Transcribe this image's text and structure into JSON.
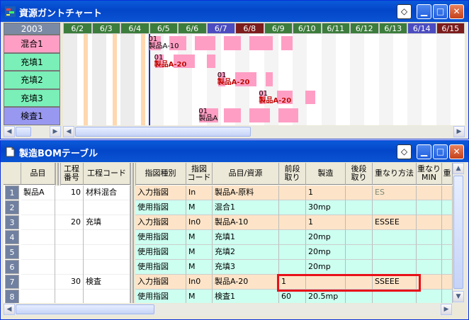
{
  "colors": {
    "title_blue": "#0a54d3",
    "bar_pink": "#ff9ec4",
    "row_orange": "#fde4c8",
    "row_cyan": "#ccfff0",
    "highlight_red": "#e8101a"
  },
  "gantt_window": {
    "title": "資源ガントチャート",
    "icon": "gantt-app-icon",
    "year": "2003",
    "days": [
      {
        "label": "6/2",
        "kind": "weekday"
      },
      {
        "label": "6/3",
        "kind": "weekday"
      },
      {
        "label": "6/4",
        "kind": "weekday"
      },
      {
        "label": "6/5",
        "kind": "weekday"
      },
      {
        "label": "6/6",
        "kind": "weekday"
      },
      {
        "label": "6/7",
        "kind": "saturday"
      },
      {
        "label": "6/8",
        "kind": "sunday"
      },
      {
        "label": "6/9",
        "kind": "weekday"
      },
      {
        "label": "6/10",
        "kind": "weekday"
      },
      {
        "label": "6/11",
        "kind": "weekday"
      },
      {
        "label": "6/12",
        "kind": "weekday"
      },
      {
        "label": "6/13",
        "kind": "weekday"
      },
      {
        "label": "6/14",
        "kind": "saturday"
      },
      {
        "label": "6/15",
        "kind": "sunday"
      }
    ],
    "resources": [
      {
        "label": "混合1",
        "color": "#ff9ec4"
      },
      {
        "label": "充填1",
        "color": "#7af0b8"
      },
      {
        "label": "充填2",
        "color": "#7af0b8"
      },
      {
        "label": "充填3",
        "color": "#7af0b8"
      },
      {
        "label": "検査1",
        "color": "#9898f0"
      }
    ],
    "tasks": [
      {
        "row": 0,
        "num": "01",
        "name": "製品A-10",
        "style": "plain",
        "start_day": 3.0,
        "segments": [
          [
            3.0,
            3.4
          ],
          [
            3.7,
            4.3
          ],
          [
            4.6,
            5.3
          ],
          [
            5.6,
            6.2
          ],
          [
            6.5,
            7.3
          ],
          [
            7.6,
            8.0
          ]
        ]
      },
      {
        "row": 1,
        "num": "01",
        "name": "製品A-20",
        "style": "outlined",
        "start_day": 3.2,
        "segments": [
          [
            3.2,
            3.5
          ],
          [
            3.85,
            4.6
          ],
          [
            5.0,
            5.3
          ]
        ]
      },
      {
        "row": 2,
        "num": "01",
        "name": "製品A-20",
        "style": "outlined",
        "start_day": 5.4,
        "segments": [
          [
            5.4,
            5.65
          ],
          [
            6.0,
            6.75
          ],
          [
            7.05,
            7.3
          ]
        ]
      },
      {
        "row": 3,
        "num": "01",
        "name": "製品A-20",
        "style": "outlined",
        "start_day": 6.85,
        "segments": [
          [
            6.85,
            7.05
          ],
          [
            7.45,
            8.0
          ],
          [
            8.45,
            8.8
          ]
        ]
      },
      {
        "row": 4,
        "num": "01",
        "name": "製品A",
        "style": "plain",
        "start_day": 4.75,
        "segments": [
          [
            4.75,
            5.4
          ],
          [
            5.6,
            6.2
          ],
          [
            6.5,
            7.2
          ],
          [
            7.5,
            8.2
          ]
        ]
      }
    ]
  },
  "bom_window": {
    "title": "製造BOMテーブル",
    "icon": "document-icon",
    "headers": [
      "品目",
      "工程\n番号",
      "工程コード",
      "指図種別",
      "指図\nコード",
      "品目/資源",
      "前段\n取り",
      "製造",
      "後段\n取り",
      "重なり方法",
      "重なり\nMIN",
      "重"
    ],
    "rows": [
      {
        "n": "1",
        "item": "製品A",
        "pnum": "10",
        "pcode": "材料混合",
        "kind": "入力指図",
        "code": "In",
        "res": "製品A-原料",
        "pre": "",
        "mfg": "1",
        "post": "",
        "method": "ES",
        "min": "",
        "method_dim": true
      },
      {
        "n": "2",
        "item": "",
        "pnum": "",
        "pcode": "",
        "kind": "使用指図",
        "code": "M",
        "res": "混合1",
        "pre": "",
        "mfg": "30mp",
        "post": "",
        "method": "",
        "min": ""
      },
      {
        "n": "3",
        "item": "",
        "pnum": "20",
        "pcode": "充填",
        "kind": "入力指図",
        "code": "In0",
        "res": "製品A-10",
        "pre": "",
        "mfg": "1",
        "post": "",
        "method": "ESSEE",
        "min": ""
      },
      {
        "n": "4",
        "item": "",
        "pnum": "",
        "pcode": "",
        "kind": "使用指図",
        "code": "M",
        "res": "充填1",
        "pre": "",
        "mfg": "20mp",
        "post": "",
        "method": "",
        "min": ""
      },
      {
        "n": "5",
        "item": "",
        "pnum": "",
        "pcode": "",
        "kind": "使用指図",
        "code": "M",
        "res": "充填2",
        "pre": "",
        "mfg": "20mp",
        "post": "",
        "method": "",
        "min": ""
      },
      {
        "n": "6",
        "item": "",
        "pnum": "",
        "pcode": "",
        "kind": "使用指図",
        "code": "M",
        "res": "充填3",
        "pre": "",
        "mfg": "20mp",
        "post": "",
        "method": "",
        "min": ""
      },
      {
        "n": "7",
        "item": "",
        "pnum": "30",
        "pcode": "検査",
        "kind": "入力指図",
        "code": "In0",
        "res": "製品A-20",
        "pre": "1",
        "mfg": "",
        "post": "",
        "method": "SSEEE",
        "min": ""
      },
      {
        "n": "8",
        "item": "",
        "pnum": "",
        "pcode": "",
        "kind": "使用指図",
        "code": "M",
        "res": "検査1",
        "pre": "60",
        "mfg": "20.5mp",
        "post": "",
        "method": "",
        "min": ""
      }
    ]
  }
}
